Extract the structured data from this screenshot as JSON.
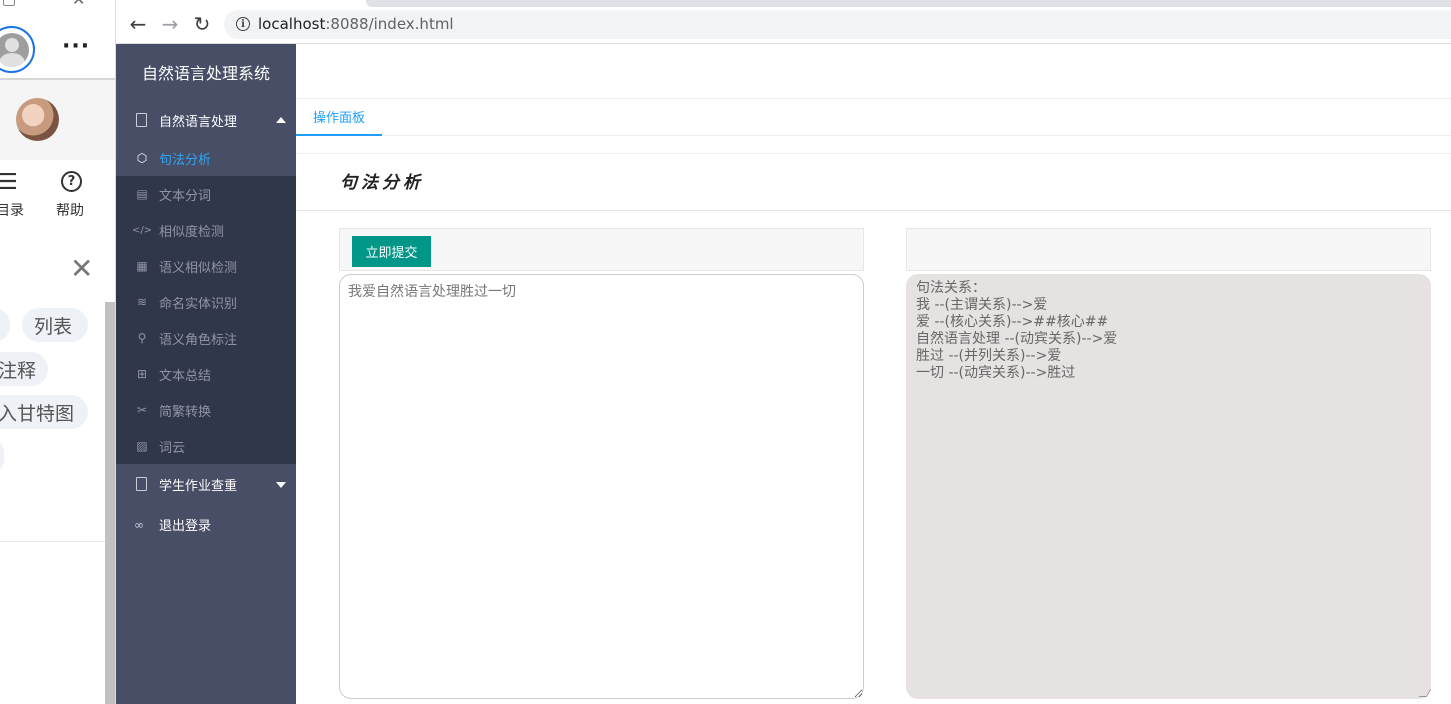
{
  "side_panel": {
    "nav_labels": {
      "menu": "目录",
      "help": "帮助"
    },
    "tags": [
      "",
      "列表",
      "注释",
      "入甘特图",
      ""
    ],
    "menu_glyph": "☰",
    "help_glyph": "?",
    "more_glyph": "···",
    "close_glyph": "✕"
  },
  "browser": {
    "url_host": "localhost",
    "url_path": ":8088/index.html",
    "back_glyph": "←",
    "forward_glyph": "→",
    "reload_glyph": "↻",
    "info_glyph": "i"
  },
  "app": {
    "title": "自然语言处理系统",
    "nav_group_1": "自然语言处理",
    "sub_items": [
      {
        "label": "句法分析",
        "icon": "cube-icon",
        "glyph": "⬡"
      },
      {
        "label": "文本分词",
        "icon": "clipboard-icon",
        "glyph": "▤"
      },
      {
        "label": "相似度检测",
        "icon": "code-icon",
        "glyph": "</>"
      },
      {
        "label": "语义相似检测",
        "icon": "grid-icon",
        "glyph": "▦"
      },
      {
        "label": "命名实体识别",
        "icon": "layers-icon",
        "glyph": "≋"
      },
      {
        "label": "语义角色标注",
        "icon": "pin-icon",
        "glyph": "⚲"
      },
      {
        "label": "文本总结",
        "icon": "book-icon",
        "glyph": "⊞"
      },
      {
        "label": "简繁转换",
        "icon": "tools-icon",
        "glyph": "✂"
      },
      {
        "label": "词云",
        "icon": "image-icon",
        "glyph": "▨"
      }
    ],
    "nav_group_2": "学生作业查重",
    "logout": "退出登录",
    "logout_glyph": "∞"
  },
  "main": {
    "tab": "操作面板",
    "section_title": "句法分析",
    "submit_label": "立即提交",
    "input_text": "我爱自然语言处理胜过一切",
    "output_lines": [
      "句法关系：",
      "我 --(主谓关系)-->爱",
      "爱 --(核心关系)-->##核心##",
      "自然语言处理 --(动宾关系)-->爱",
      "胜过 --(并列关系)-->爱",
      "一切 --(动宾关系)-->胜过"
    ]
  },
  "colors": {
    "sidebar_bg": "#474e66",
    "submenu_bg": "#31374a",
    "active_text": "#2ea8f5",
    "tab_accent": "#1e9fff",
    "submit_bg": "#009688",
    "output_bg": "#e6e2e1"
  }
}
